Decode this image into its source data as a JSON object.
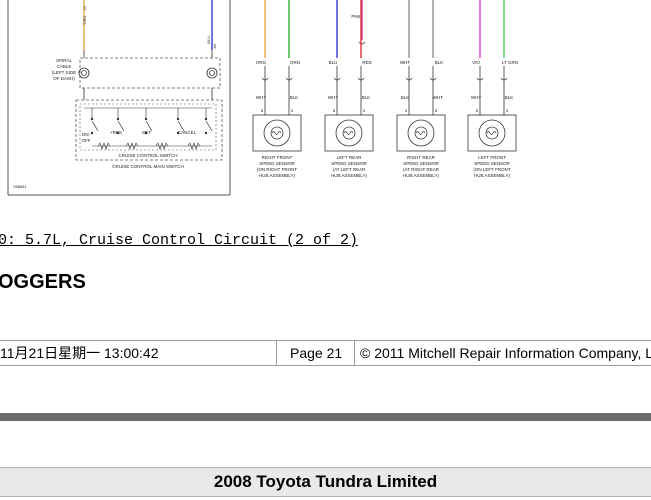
{
  "diagram": {
    "wires_top": [
      "PNK"
    ],
    "left_wire_labels": [
      "ORN",
      "BLU"
    ],
    "left_pin_numbers": [
      "12",
      "A5"
    ],
    "spiral_cable_label": [
      "SPIRAL",
      "CABLE",
      "(LEFT SIDE",
      "OF DASH)"
    ],
    "switch_labels": [
      "ON-",
      "OFF",
      "+RES",
      "-SET",
      "CANCEL"
    ],
    "switch_caption": "CRUISE CONTROL SWITCH",
    "main_switch_caption": "CRUISE CONTROL MAIN SWITCH",
    "figure_number": "298841",
    "sensors": [
      {
        "wires_top": [
          "ORG",
          "GRN"
        ],
        "wires_bottom": [
          "WHT",
          "BLK"
        ],
        "pins": [
          "2",
          "1"
        ],
        "label": [
          "RIGHT FRONT",
          "SPEED SENSOR",
          "(ON RIGHT FRONT",
          "HUB ASSEMBLY)"
        ]
      },
      {
        "wires_top": [
          "BLU",
          "RED"
        ],
        "wires_bottom": [
          "WHT",
          "BLK"
        ],
        "pins": [
          "2",
          "1"
        ],
        "label": [
          "LEFT REAR",
          "SPEED SENSOR",
          "(AT LEFT REAR",
          "HUB ASSEMBLY)"
        ]
      },
      {
        "wires_top": [
          "WHT",
          "BLK"
        ],
        "wires_bottom": [
          "BLK",
          "WHT"
        ],
        "pins": [
          "1",
          "2"
        ],
        "label": [
          "RIGHT REAR",
          "SPEED SENSOR",
          "(AT RIGHT REAR",
          "HUB ASSEMBLY)"
        ]
      },
      {
        "wires_top": [
          "VIO",
          "LT GRN"
        ],
        "wires_bottom": [
          "WHT",
          "BLK"
        ],
        "pins": [
          "2",
          "1"
        ],
        "label": [
          "LEFT FRONT",
          "SPEED SENSOR",
          "(ON LEFT FRONT",
          "HUB ASSEMBLY)"
        ]
      }
    ],
    "colors": {
      "orange": "#e8a33a",
      "green": "#22aa22",
      "blue": "#2a2ad8",
      "red": "#dd2222",
      "violet": "#cc33cc",
      "light_green": "#44cc44",
      "gray": "#888888",
      "wire": "#333333"
    }
  },
  "caption": "0: 5.7L, Cruise Control Circuit (2 of 2)",
  "section_title": "OGGERS",
  "footer": {
    "date": "11月21日星期一 13:00:42",
    "page": "Page 21",
    "copyright": "© 2011 Mitchell Repair Information Company, L"
  },
  "vehicle_title": "2008 Toyota Tundra Limited"
}
